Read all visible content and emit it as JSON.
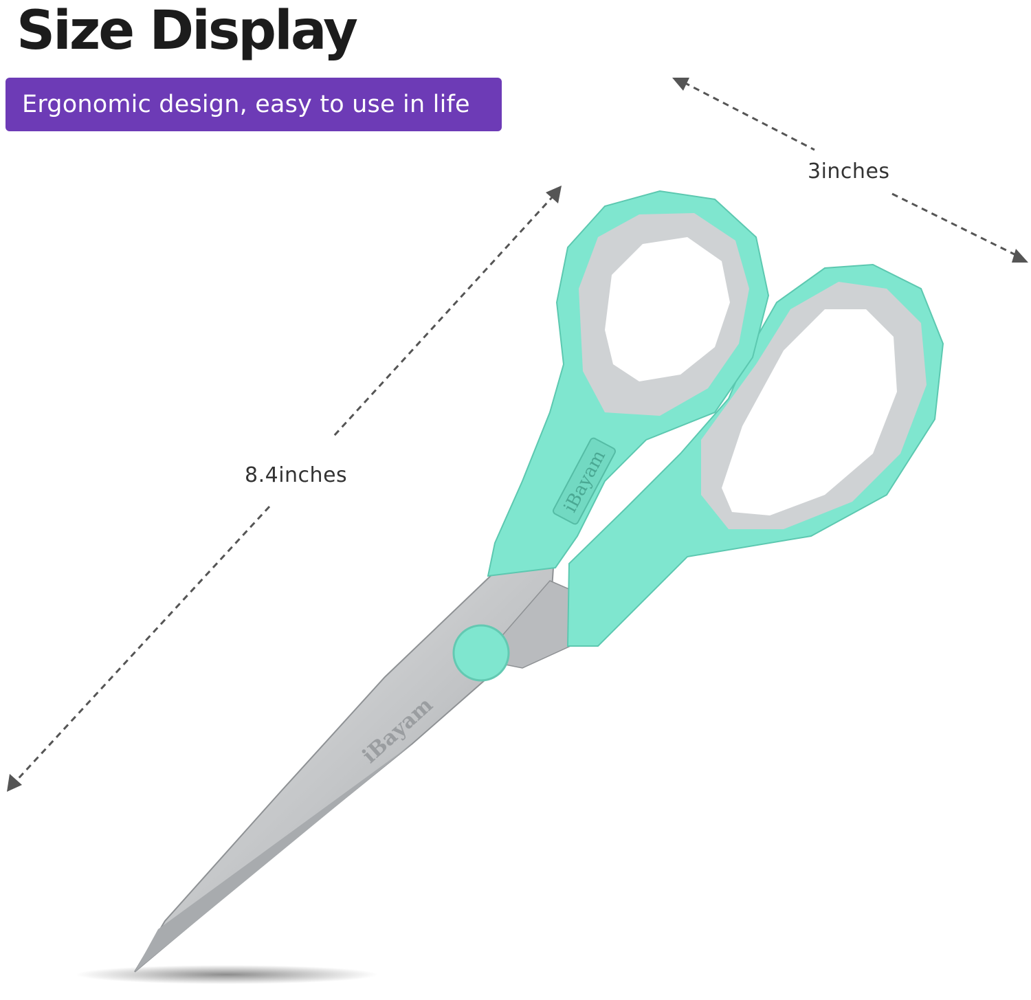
{
  "title": "Size Display",
  "badge": {
    "text": "Ergonomic design, easy to use in life",
    "color": "#6d3bb6"
  },
  "dimensions": {
    "width_label": "3inches",
    "length_label": "8.4inches"
  },
  "product": {
    "brand_handle": "iBayam",
    "brand_blade": "iBayam",
    "handle_color": "#7fe6cf",
    "grip_color": "#cfd2d4",
    "blade_color": "#c9cbcd"
  }
}
